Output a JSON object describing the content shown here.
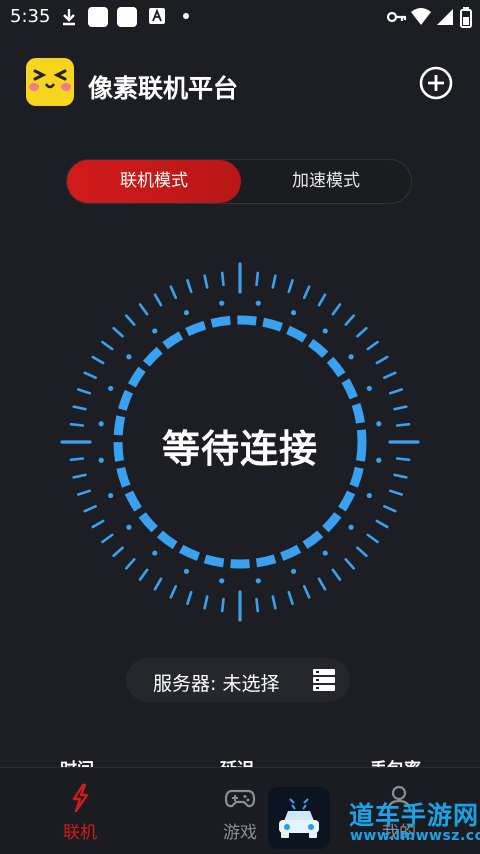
{
  "status_bar": {
    "time": "5:35",
    "icons": [
      "download-icon",
      "app-square-icon",
      "app-square-icon",
      "font-a-icon",
      "dot-icon",
      "vpn-key-icon",
      "wifi-icon",
      "signal-icon",
      "battery-icon"
    ]
  },
  "header": {
    "title": "像素联机平台",
    "logo_icon": "pixel-face-logo-icon",
    "add_icon": "plus-circle-icon"
  },
  "modes": {
    "active": "联机模式",
    "inactive": "加速模式"
  },
  "dial": {
    "status": "等待连接",
    "accent": "#3aa0f0"
  },
  "server": {
    "label": "服务器: 未选择",
    "icon": "server-list-icon"
  },
  "stats": {
    "time_label": "时间",
    "latency_label": "延迟",
    "loss_label": "丢包率"
  },
  "nav": {
    "items": [
      {
        "label": "联机",
        "icon": "lightning-icon",
        "active": true
      },
      {
        "label": "游戏",
        "icon": "gamepad-icon",
        "active": false
      },
      {
        "label": "我的",
        "icon": "user-icon",
        "active": false
      }
    ]
  },
  "watermark": {
    "title": "道车手游网",
    "url": "www.lmwwsz.com"
  },
  "colors": {
    "background": "#1c1e23",
    "primary_red": "#d31b1b",
    "accent_blue": "#3aa0f0",
    "watermark_blue": "#1aa3e8"
  }
}
